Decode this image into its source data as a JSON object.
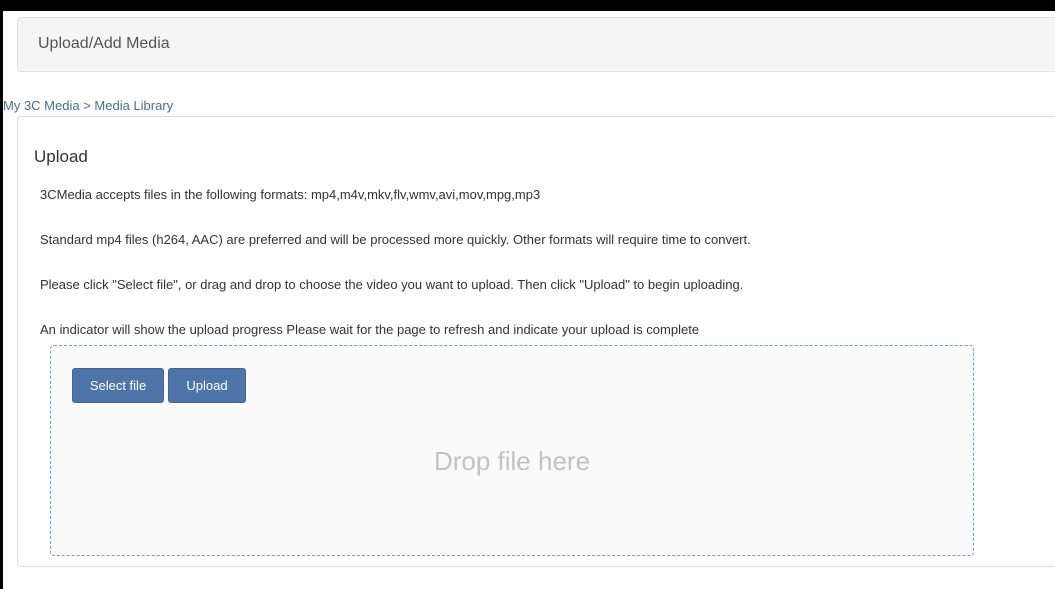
{
  "header": {
    "title": "Upload/Add Media"
  },
  "breadcrumb": {
    "items": [
      "My 3C Media",
      "Media Library"
    ],
    "separator": ">"
  },
  "upload_panel": {
    "title": "Upload",
    "lines": [
      "3CMedia accepts files in the following formats: mp4,m4v,mkv,flv,wmv,avi,mov,mpg,mp3",
      "Standard mp4 files (h264, AAC) are preferred and will be processed more quickly. Other formats will require time to convert.",
      "Please click \"Select file\", or drag and drop to choose the video you want to upload. Then click \"Upload\" to begin uploading.",
      "An indicator will show the upload progress Please wait for the page to refresh and indicate your upload is complete"
    ],
    "dropzone": {
      "select_label": "Select file",
      "upload_label": "Upload",
      "drop_text": "Drop file here"
    }
  },
  "colors": {
    "button_bg": "#4f74aa",
    "link": "#4a6f94",
    "dropzone_border": "#6f9fd0"
  }
}
